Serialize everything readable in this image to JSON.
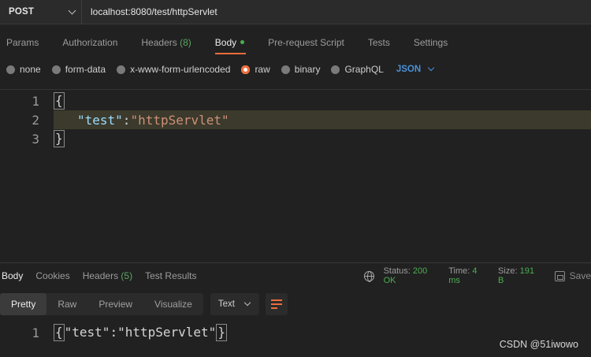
{
  "request": {
    "method": "POST",
    "url": "localhost:8080/test/httpServlet"
  },
  "request_tabs": [
    {
      "label": "Params"
    },
    {
      "label": "Authorization"
    },
    {
      "label": "Headers",
      "count": "(8)"
    },
    {
      "label": "Body",
      "active": true
    },
    {
      "label": "Pre-request Script"
    },
    {
      "label": "Tests"
    },
    {
      "label": "Settings"
    }
  ],
  "body_types": {
    "options": [
      "none",
      "form-data",
      "x-www-form-urlencoded",
      "raw",
      "binary",
      "GraphQL"
    ],
    "selected": "raw",
    "format": "JSON"
  },
  "editor": {
    "lines": [
      {
        "num": "1",
        "text": "{"
      },
      {
        "num": "2",
        "key": "\"test\"",
        "colon": ":",
        "value": "\"httpServlet\""
      },
      {
        "num": "3",
        "text": "}"
      }
    ]
  },
  "response_tabs": [
    {
      "label": "Body",
      "active": true
    },
    {
      "label": "Cookies"
    },
    {
      "label": "Headers",
      "count": "(5)"
    },
    {
      "label": "Test Results"
    }
  ],
  "response_meta": {
    "status_label": "Status:",
    "status_value": "200 OK",
    "time_label": "Time:",
    "time_value": "4 ms",
    "size_label": "Size:",
    "size_value": "191 B",
    "save_label": "Save"
  },
  "response_format": {
    "modes": [
      "Pretty",
      "Raw",
      "Preview",
      "Visualize"
    ],
    "active": "Pretty",
    "type": "Text"
  },
  "response_body": {
    "num": "1",
    "open": "{",
    "key": "\"test\"",
    "colon": ":",
    "value": "\"httpServlet\"",
    "close": "}"
  },
  "watermark": "CSDN @51iwowo",
  "colors": {
    "accent": "#ef6c3a",
    "success": "#4cae4f",
    "link": "#4a90d9",
    "background": "#212121"
  }
}
